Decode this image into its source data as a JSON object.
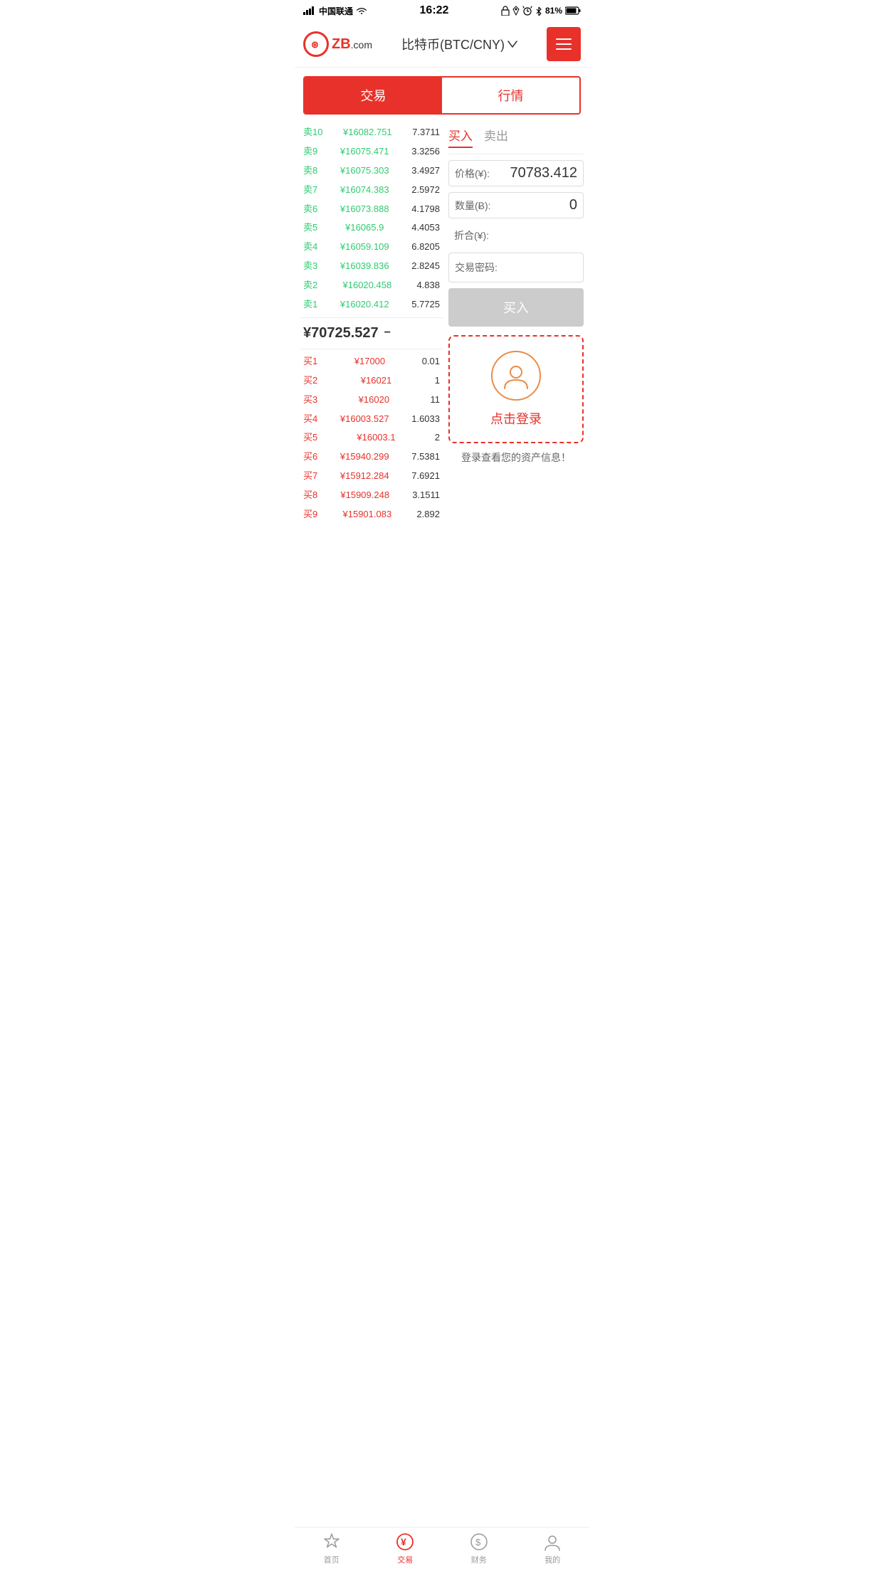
{
  "statusBar": {
    "carrier": "中国联通",
    "time": "16:22",
    "battery": "81%"
  },
  "header": {
    "logoText": "ZB",
    "logoDomain": ".com",
    "title": "比特币(BTC/CNY)",
    "menuLabel": "menu"
  },
  "tabs": {
    "trade": "交易",
    "market": "行情"
  },
  "orderBook": {
    "sellOrders": [
      {
        "label": "卖10",
        "price": "¥16082.751",
        "qty": "7.3711"
      },
      {
        "label": "卖9",
        "price": "¥16075.471",
        "qty": "3.3256"
      },
      {
        "label": "卖8",
        "price": "¥16075.303",
        "qty": "3.4927"
      },
      {
        "label": "卖7",
        "price": "¥16074.383",
        "qty": "2.5972"
      },
      {
        "label": "卖6",
        "price": "¥16073.888",
        "qty": "4.1798"
      },
      {
        "label": "卖5",
        "price": "¥16065.9",
        "qty": "4.4053"
      },
      {
        "label": "卖4",
        "price": "¥16059.109",
        "qty": "6.8205"
      },
      {
        "label": "卖3",
        "price": "¥16039.836",
        "qty": "2.8245"
      },
      {
        "label": "卖2",
        "price": "¥16020.458",
        "qty": "4.838"
      },
      {
        "label": "卖1",
        "price": "¥16020.412",
        "qty": "5.7725"
      }
    ],
    "currentPrice": "¥70725.527",
    "priceDirection": "−",
    "buyOrders": [
      {
        "label": "买1",
        "price": "¥17000",
        "qty": "0.01"
      },
      {
        "label": "买2",
        "price": "¥16021",
        "qty": "1"
      },
      {
        "label": "买3",
        "price": "¥16020",
        "qty": "11"
      },
      {
        "label": "买4",
        "price": "¥16003.527",
        "qty": "1.6033"
      },
      {
        "label": "买5",
        "price": "¥16003.1",
        "qty": "2"
      },
      {
        "label": "买6",
        "price": "¥15940.299",
        "qty": "7.5381"
      },
      {
        "label": "买7",
        "price": "¥15912.284",
        "qty": "7.6921"
      },
      {
        "label": "买8",
        "price": "¥15909.248",
        "qty": "3.1511"
      },
      {
        "label": "买9",
        "price": "¥15901.083",
        "qty": "2.892"
      }
    ]
  },
  "tradePanel": {
    "buyTab": "买入",
    "sellTab": "卖出",
    "priceLabel": "价格(¥):",
    "priceValue": "70783.412",
    "qtyLabel": "数量(Ƀ):",
    "qtyValue": "0",
    "totalLabel": "折合(¥):",
    "passwordLabel": "交易密码:",
    "buyButton": "买入"
  },
  "loginPrompt": {
    "clickLogin": "点击登录",
    "hint": "登录查看您的资产信息！"
  },
  "bottomNav": [
    {
      "label": "首页",
      "icon": "star",
      "active": false
    },
    {
      "label": "交易",
      "icon": "yuan",
      "active": true
    },
    {
      "label": "财务",
      "icon": "bag",
      "active": false
    },
    {
      "label": "我的",
      "icon": "person",
      "active": false
    }
  ]
}
